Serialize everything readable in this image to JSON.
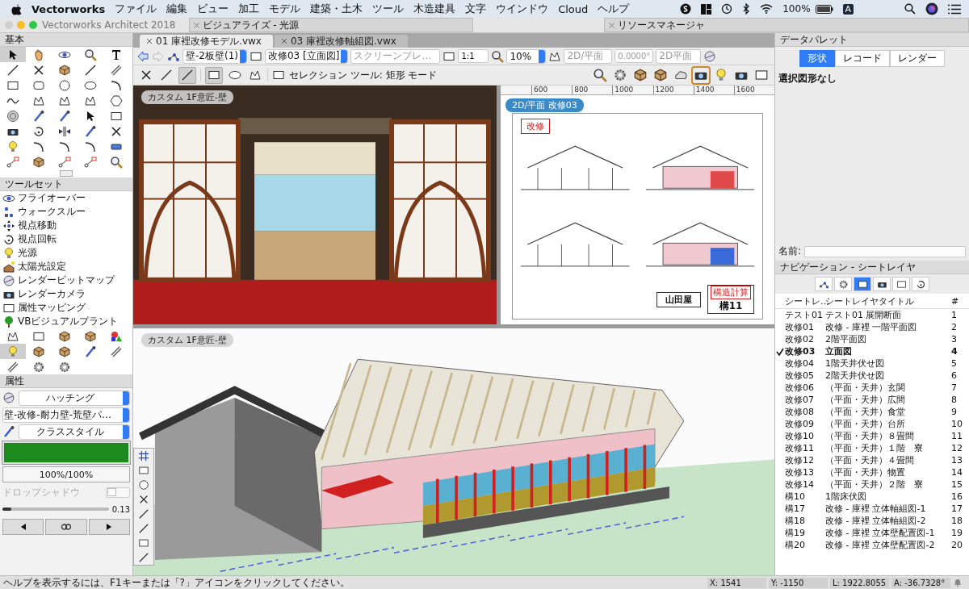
{
  "menubar": {
    "app": "Vectorworks",
    "items": [
      "ファイル",
      "編集",
      "ビュー",
      "加工",
      "モデル",
      "建築・土木",
      "ツール",
      "木造建具",
      "文字",
      "ウインドウ",
      "Cloud",
      "ヘルプ"
    ],
    "battery": "100%",
    "input_mode": "A"
  },
  "window": {
    "title": "Vectorworks Architect 2018"
  },
  "floating_palettes": [
    {
      "title": "ビジュアライズ - 光源"
    },
    {
      "title": "リソースマネージャ"
    }
  ],
  "document_tabs": [
    {
      "label": "01 庫裡改修モデル.vwx",
      "selected": true
    },
    {
      "label": "03 庫裡改修軸組図.vwx",
      "selected": false
    }
  ],
  "view_bar": {
    "wall_style": "壁-2板壁(1)",
    "sheet": "改修03 [立面図]",
    "render_mode": "スクリーンプレ…",
    "scale": "1:1",
    "zoom": "10%",
    "view": "2D/平面",
    "rotation": "0.0000°",
    "projection": "2D平面"
  },
  "tool_bar": {
    "mode_hint": "セレクション ツール: 矩形 モード",
    "selection_modes": [
      {
        "selected": false
      },
      {
        "selected": false
      },
      {
        "selected": true
      }
    ],
    "marquee_shapes": [
      {
        "selected": true
      },
      {
        "selected": false
      },
      {
        "selected": false
      }
    ]
  },
  "basic_palette": {
    "title": "基本"
  },
  "toolset_palette": {
    "title": "ツールセット",
    "items": [
      "フライオーバー",
      "ウォークスルー",
      "視点移動",
      "視点回転",
      "光源",
      "太陽光設定",
      "レンダービットマップ",
      "レンダーカメラ",
      "属性マッピング",
      "VBビジュアルプラント"
    ]
  },
  "attributes": {
    "title": "属性",
    "fill_type": "ハッチング",
    "hatch": "壁-改修-耐力壁-荒壁パ…",
    "pen": "クラススタイル",
    "opacity": "100%/100%",
    "drop_shadow": {
      "label": "ドロップシャドウ",
      "disabled": true,
      "on": false
    },
    "line_weight": {
      "level": 0.08,
      "reading": "0.13"
    }
  },
  "viewports": [
    {
      "label": "カスタム 1F意匠-壁",
      "kind": "interior"
    },
    {
      "label": "2D/平面 改修03",
      "kind": "sheet"
    },
    {
      "label": "カスタム 1F意匠-壁",
      "kind": "model"
    }
  ],
  "ruler": {
    "ticks": [
      "600",
      "800",
      "1000",
      "1200",
      "1400",
      "1600"
    ]
  },
  "sheet": {
    "stamp": "改修",
    "owner": "山田屋",
    "badge": "構造計算",
    "number": "構11"
  },
  "data_palette": {
    "title": "データパレット",
    "tabs": [
      {
        "label": "形状",
        "selected": true
      },
      {
        "label": "レコード",
        "selected": false
      },
      {
        "label": "レンダー",
        "selected": false
      }
    ],
    "empty": "選択図形なし",
    "name_label": "名前:"
  },
  "navigation": {
    "title": "ナビゲーション - シートレイヤ",
    "views": [
      {
        "selected": false
      },
      {
        "selected": false
      },
      {
        "selected": true
      },
      {
        "selected": false
      },
      {
        "selected": false
      },
      {
        "selected": false
      }
    ],
    "columns": [
      "シートレ…",
      "シートレイヤタイトル",
      "#"
    ],
    "rows": [
      {
        "name": "テスト01",
        "title": "テスト01 展開断面",
        "number": "1",
        "active": false
      },
      {
        "name": "改修01",
        "title": "改修 - 庫裡 一階平面図",
        "number": "2",
        "active": false
      },
      {
        "name": "改修02",
        "title": "2階平面図",
        "number": "3",
        "active": false
      },
      {
        "name": "改修03",
        "title": "立面図",
        "number": "4",
        "active": true
      },
      {
        "name": "改修04",
        "title": "1階天井伏せ図",
        "number": "5",
        "active": false
      },
      {
        "name": "改修05",
        "title": "2階天井伏せ図",
        "number": "6",
        "active": false
      },
      {
        "name": "改修06",
        "title": "（平面・天井）玄関",
        "number": "7",
        "active": false
      },
      {
        "name": "改修07",
        "title": "（平面・天井）広間",
        "number": "8",
        "active": false
      },
      {
        "name": "改修08",
        "title": "（平面・天井）食堂",
        "number": "9",
        "active": false
      },
      {
        "name": "改修09",
        "title": "（平面・天井）台所",
        "number": "10",
        "active": false
      },
      {
        "name": "改修10",
        "title": "（平面・天井）８畳間",
        "number": "11",
        "active": false
      },
      {
        "name": "改修11",
        "title": "（平面・天井）１階　寮",
        "number": "12",
        "active": false
      },
      {
        "name": "改修12",
        "title": "（平面・天井）４畳間",
        "number": "13",
        "active": false
      },
      {
        "name": "改修13",
        "title": "（平面・天井）物置",
        "number": "14",
        "active": false
      },
      {
        "name": "改修14",
        "title": "（平面・天井）２階　寮",
        "number": "15",
        "active": false
      },
      {
        "name": "構10",
        "title": "1階床伏図",
        "number": "16",
        "active": false
      },
      {
        "name": "構17",
        "title": "改修 - 庫裡 立体軸組図-1",
        "number": "17",
        "active": false
      },
      {
        "name": "構18",
        "title": "改修 - 庫裡 立体軸組図-2",
        "number": "18",
        "active": false
      },
      {
        "name": "構19",
        "title": "改修 - 庫裡 立体壁配置図-1",
        "number": "19",
        "active": false
      },
      {
        "name": "構20",
        "title": "改修 - 庫裡 立体壁配置図-2",
        "number": "20",
        "active": false
      }
    ]
  },
  "status_bar": {
    "help": "ヘルプを表示するには、F1キーまたは「?」アイコンをクリックしてください。",
    "fields": [
      "X:  1541",
      "Y:  -1150",
      "L:  1922.8055",
      "A:  -36.7328°"
    ]
  }
}
